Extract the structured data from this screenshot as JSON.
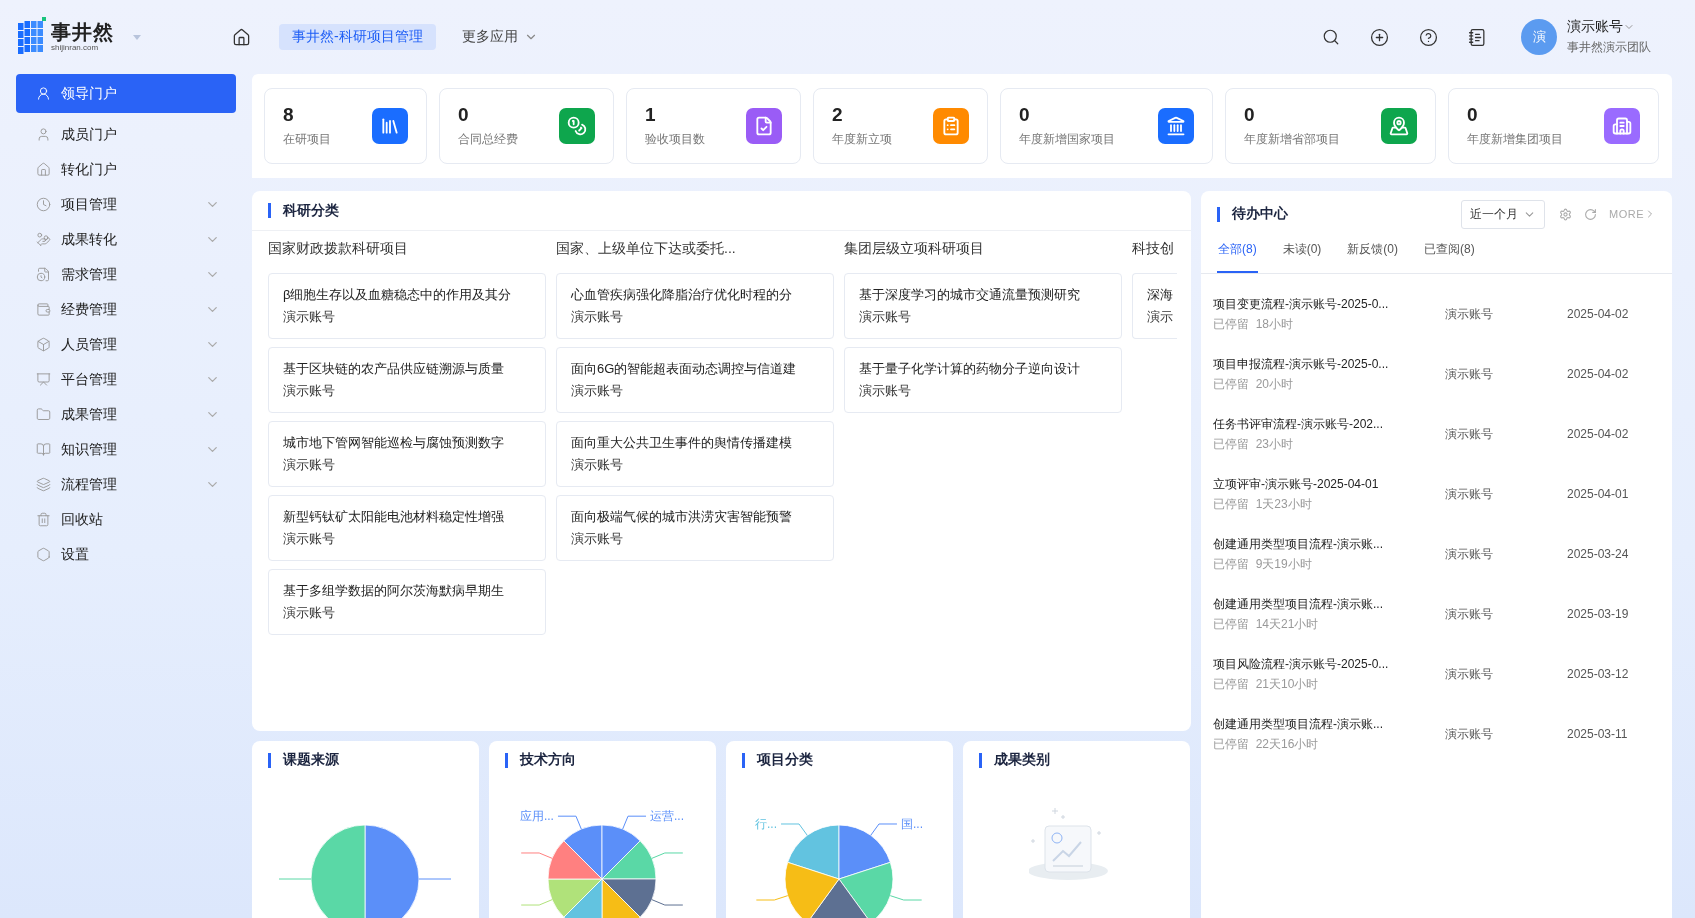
{
  "header": {
    "logo_name": "事井然",
    "logo_domain": "shijinran.com",
    "apps": [
      {
        "label": "事井然-科研项目管理",
        "selected": true
      }
    ],
    "more_apps": "更多应用",
    "user": {
      "avatar_text": "演",
      "name": "演示账号",
      "team": "事井然演示团队"
    }
  },
  "sidebar": {
    "items": [
      {
        "label": "领导门户",
        "kind": "link",
        "selected": true
      },
      {
        "label": "成员门户",
        "kind": "link",
        "selected": false
      },
      {
        "label": "转化门户",
        "kind": "link",
        "selected": false
      },
      {
        "label": "项目管理",
        "kind": "group",
        "selected": false
      },
      {
        "label": "成果转化",
        "kind": "group",
        "selected": false
      },
      {
        "label": "需求管理",
        "kind": "group",
        "selected": false
      },
      {
        "label": "经费管理",
        "kind": "group",
        "selected": false
      },
      {
        "label": "人员管理",
        "kind": "group",
        "selected": false
      },
      {
        "label": "平台管理",
        "kind": "group",
        "selected": false
      },
      {
        "label": "成果管理",
        "kind": "group",
        "selected": false
      },
      {
        "label": "知识管理",
        "kind": "group",
        "selected": false
      },
      {
        "label": "流程管理",
        "kind": "group",
        "selected": false
      },
      {
        "label": "回收站",
        "kind": "link",
        "selected": false
      },
      {
        "label": "设置",
        "kind": "link",
        "selected": false
      }
    ]
  },
  "stats": [
    {
      "value": "8",
      "label": "在研项目",
      "color": "#1a6dff"
    },
    {
      "value": "0",
      "label": "合同总经费",
      "color": "#0ea64d"
    },
    {
      "value": "1",
      "label": "验收项目数",
      "color": "#9a5cf6"
    },
    {
      "value": "2",
      "label": "年度新立项",
      "color": "#ff8a00"
    },
    {
      "value": "0",
      "label": "年度新增国家项目",
      "color": "#1a6dff"
    },
    {
      "value": "0",
      "label": "年度新增省部项目",
      "color": "#0ea64d"
    },
    {
      "value": "0",
      "label": "年度新增集团项目",
      "color": "#9a6bff"
    }
  ],
  "research": {
    "title": "科研分类",
    "columns": [
      {
        "title": "国家财政拨款科研项目",
        "cards": [
          {
            "title": "β细胞生存以及血糖稳态中的作用及其分",
            "owner": "演示账号"
          },
          {
            "title": "基于区块链的农产品供应链溯源与质量",
            "owner": "演示账号"
          },
          {
            "title": "城市地下管网智能巡检与腐蚀预测数字",
            "owner": "演示账号"
          },
          {
            "title": "新型钙钛矿太阳能电池材料稳定性增强",
            "owner": "演示账号"
          },
          {
            "title": "基于多组学数据的阿尔茨海默病早期生",
            "owner": "演示账号"
          }
        ]
      },
      {
        "title": "国家、上级单位下达或委托...",
        "cards": [
          {
            "title": "心血管疾病强化降脂治疗优化时程的分",
            "owner": "演示账号"
          },
          {
            "title": "面向6G的智能超表面动态调控与信道建",
            "owner": "演示账号"
          },
          {
            "title": "面向重大公共卫生事件的舆情传播建模",
            "owner": "演示账号"
          },
          {
            "title": "面向极端气候的城市洪涝灾害智能预警",
            "owner": "演示账号"
          }
        ]
      },
      {
        "title": "集团层级立项科研项目",
        "cards": [
          {
            "title": "基于深度学习的城市交通流量预测研究",
            "owner": "演示账号"
          },
          {
            "title": "基于量子化学计算的药物分子逆向设计",
            "owner": "演示账号"
          }
        ]
      },
      {
        "title": "科技创",
        "cards": [
          {
            "title": "深海",
            "owner": "演示"
          }
        ]
      }
    ]
  },
  "charts": [
    {
      "title": "课题来源",
      "kind": "pie",
      "slices": [
        {
          "color": "#5b8ff9"
        },
        {
          "color": "#5ad8a6"
        }
      ]
    },
    {
      "title": "技术方向",
      "kind": "pie",
      "slices": [
        {
          "color": "#5b8ff9",
          "label": "应用..."
        },
        {
          "color": "#5b8ff9",
          "label": "运营..."
        },
        {
          "color": "#5ad8a6"
        },
        {
          "color": "#5d7092"
        },
        {
          "color": "#f6bd16"
        },
        {
          "color": "#62c3e0"
        },
        {
          "color": "#b0e27a"
        },
        {
          "color": "#ff8080"
        }
      ]
    },
    {
      "title": "项目分类",
      "kind": "pie",
      "slices": [
        {
          "color": "#62c3e0",
          "label": "行..."
        },
        {
          "color": "#5b8ff9",
          "label": "国..."
        },
        {
          "color": "#5ad8a6"
        },
        {
          "color": "#5d7092"
        },
        {
          "color": "#f6bd16"
        }
      ]
    },
    {
      "title": "成果类别",
      "kind": "empty"
    }
  ],
  "todo": {
    "title": "待办中心",
    "period": "近一个月",
    "more": "MORE",
    "tabs": [
      {
        "label": "全部(8)",
        "selected": true
      },
      {
        "label": "未读(0)",
        "selected": false
      },
      {
        "label": "新反馈(0)",
        "selected": false
      },
      {
        "label": "已查阅(8)",
        "selected": false
      }
    ],
    "rows": [
      {
        "title": "项目变更流程-演示账号-2025-0...",
        "stay": "已停留  18小时",
        "user": "演示账号",
        "date": "2025-04-02"
      },
      {
        "title": "项目申报流程-演示账号-2025-0...",
        "stay": "已停留  20小时",
        "user": "演示账号",
        "date": "2025-04-02"
      },
      {
        "title": "任务书评审流程-演示账号-202...",
        "stay": "已停留  23小时",
        "user": "演示账号",
        "date": "2025-04-02"
      },
      {
        "title": "立项评审-演示账号-2025-04-01",
        "stay": "已停留  1天23小时",
        "user": "演示账号",
        "date": "2025-04-01"
      },
      {
        "title": "创建通用类型项目流程-演示账...",
        "stay": "已停留  9天19小时",
        "user": "演示账号",
        "date": "2025-03-24"
      },
      {
        "title": "创建通用类型项目流程-演示账...",
        "stay": "已停留  14天21小时",
        "user": "演示账号",
        "date": "2025-03-19"
      },
      {
        "title": "项目风险流程-演示账号-2025-0...",
        "stay": "已停留  21天10小时",
        "user": "演示账号",
        "date": "2025-03-12"
      },
      {
        "title": "创建通用类型项目流程-演示账...",
        "stay": "已停留  22天16小时",
        "user": "演示账号",
        "date": "2025-03-11"
      }
    ]
  }
}
